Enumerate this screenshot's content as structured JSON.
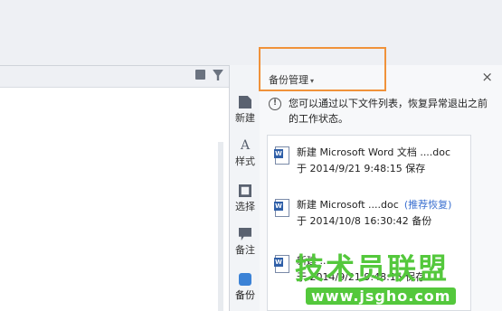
{
  "vertical_toolbar": {
    "items": [
      {
        "label": "新建",
        "icon": "new-doc-icon"
      },
      {
        "label": "样式",
        "icon": "style-icon"
      },
      {
        "label": "选择",
        "icon": "select-icon"
      },
      {
        "label": "备注",
        "icon": "note-icon"
      },
      {
        "label": "备份",
        "icon": "backup-icon"
      }
    ]
  },
  "panel": {
    "title": "备份管理",
    "dropdown_caret": "▾",
    "close": "×",
    "info_text": "您可以通过以下文件列表，恢复异常退出之前的工作状态。"
  },
  "backup_list": [
    {
      "title": "新建 Microsoft Word 文档 ....doc",
      "subtitle": "于 2014/9/21 9:48:15 保存",
      "tag": ""
    },
    {
      "title": "新建 Microsoft ....doc",
      "subtitle": "于 2014/10/8 16:30:42 备份",
      "tag": "(推荐恢复)"
    },
    {
      "title": "新建 ...",
      "subtitle": "于 2014/9/21 9:48:15 保存",
      "tag": ""
    }
  ],
  "watermark": {
    "brand": "技术员联盟",
    "url": "www.jsgho.com"
  },
  "colors": {
    "highlight": "#f0923a",
    "watermark_green": "#54c83c",
    "accent_blue": "#3a6fd0"
  }
}
